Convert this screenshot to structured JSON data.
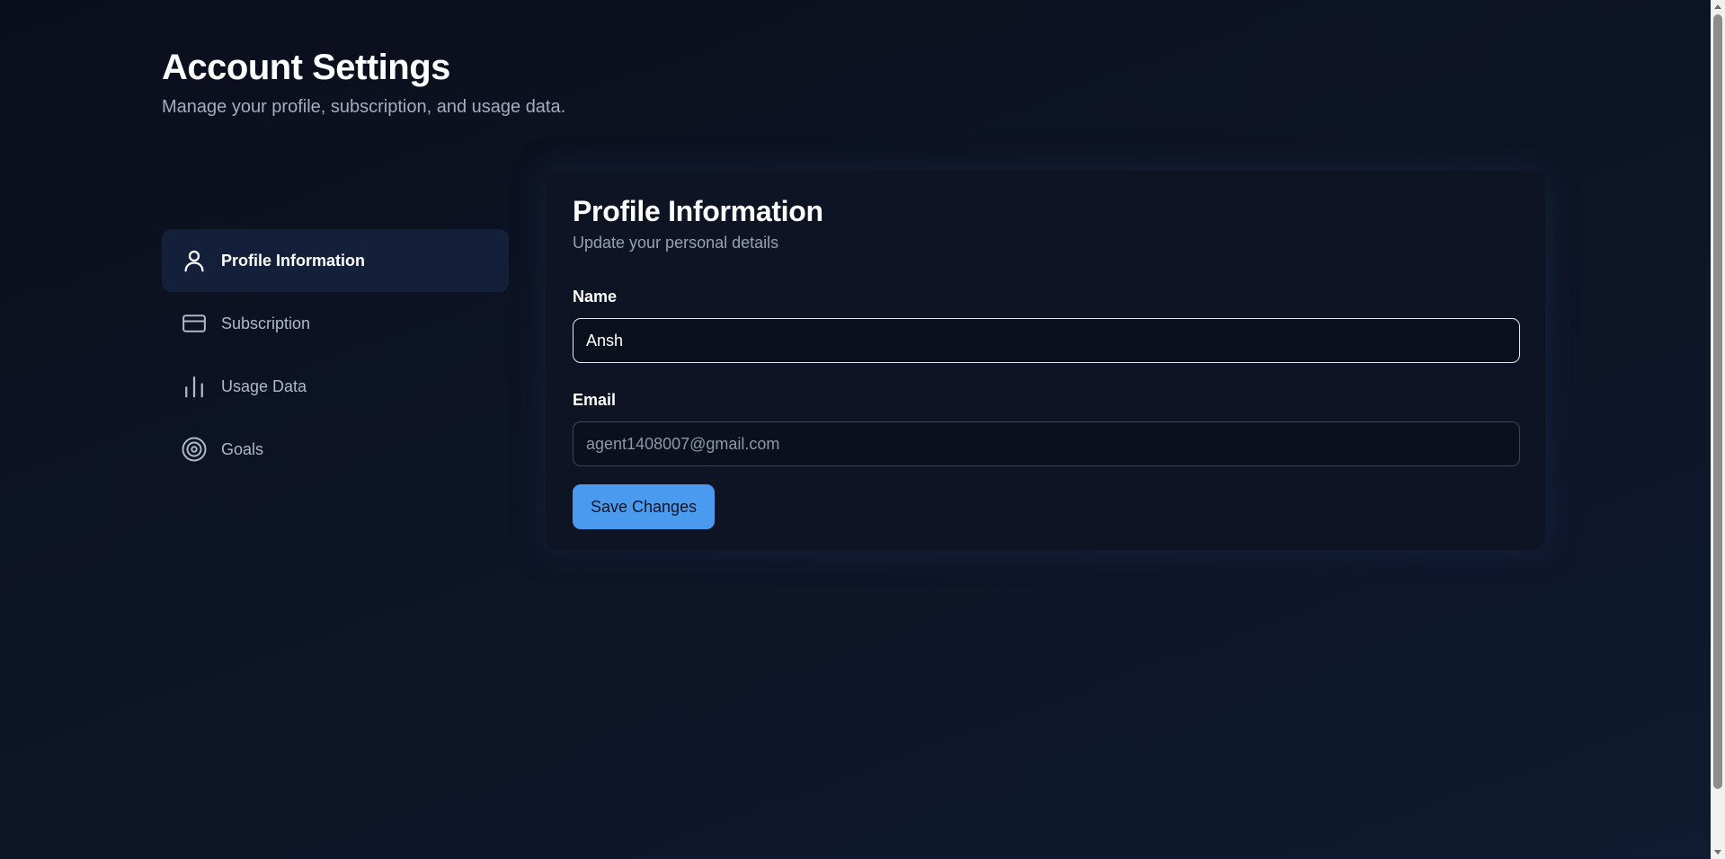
{
  "header": {
    "title": "Account Settings",
    "subtitle": "Manage your profile, subscription, and usage data."
  },
  "sidebar": {
    "active_index": 0,
    "items": [
      {
        "label": "Profile Information",
        "icon": "user-icon"
      },
      {
        "label": "Subscription",
        "icon": "credit-card-icon"
      },
      {
        "label": "Usage Data",
        "icon": "bar-chart-icon"
      },
      {
        "label": "Goals",
        "icon": "target-icon"
      }
    ]
  },
  "profile_card": {
    "title": "Profile Information",
    "subtitle": "Update your personal details",
    "name_label": "Name",
    "name_value": "Ansh",
    "email_label": "Email",
    "email_placeholder": "agent1408007@gmail.com",
    "email_value": "",
    "save_label": "Save Changes"
  },
  "colors": {
    "accent": "#4a9bf0",
    "active_nav_bg": "#14203a",
    "card_bg": "#0e1424"
  }
}
